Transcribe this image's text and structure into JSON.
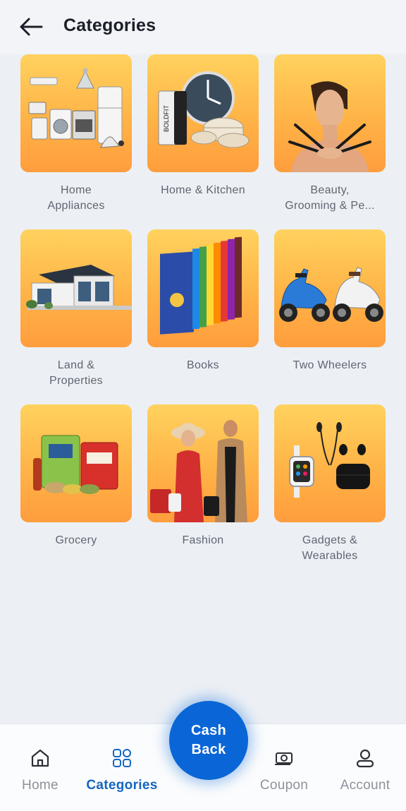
{
  "header": {
    "title": "Categories",
    "back_icon": "arrow-left-icon"
  },
  "categories": [
    {
      "label": "Home\nAppliances",
      "image": "home-appliances-image"
    },
    {
      "label": "Home & Kitchen",
      "image": "home-kitchen-image"
    },
    {
      "label": "Beauty,\nGrooming & Pe...",
      "image": "beauty-grooming-image"
    },
    {
      "label": "Land &\nProperties",
      "image": "land-properties-image"
    },
    {
      "label": "Books",
      "image": "books-image"
    },
    {
      "label": "Two Wheelers",
      "image": "two-wheelers-image"
    },
    {
      "label": "Grocery",
      "image": "grocery-image"
    },
    {
      "label": "Fashion",
      "image": "fashion-image"
    },
    {
      "label": "Gadgets &\nWearables",
      "image": "gadgets-wearables-image"
    }
  ],
  "bottom_nav": {
    "items": [
      {
        "label": "Home",
        "icon": "home-icon",
        "active": false
      },
      {
        "label": "Categories",
        "icon": "grid-icon",
        "active": true
      },
      {
        "label": "Coupon",
        "icon": "coupon-icon",
        "active": false
      },
      {
        "label": "Account",
        "icon": "user-icon",
        "active": false
      }
    ],
    "cashback": {
      "line1": "Cash",
      "line2": "Back"
    }
  },
  "colors": {
    "accent": "#0a66d6",
    "active_nav": "#1565c0",
    "tile_top": "#ffd25e",
    "tile_bottom": "#ff9d3d"
  }
}
